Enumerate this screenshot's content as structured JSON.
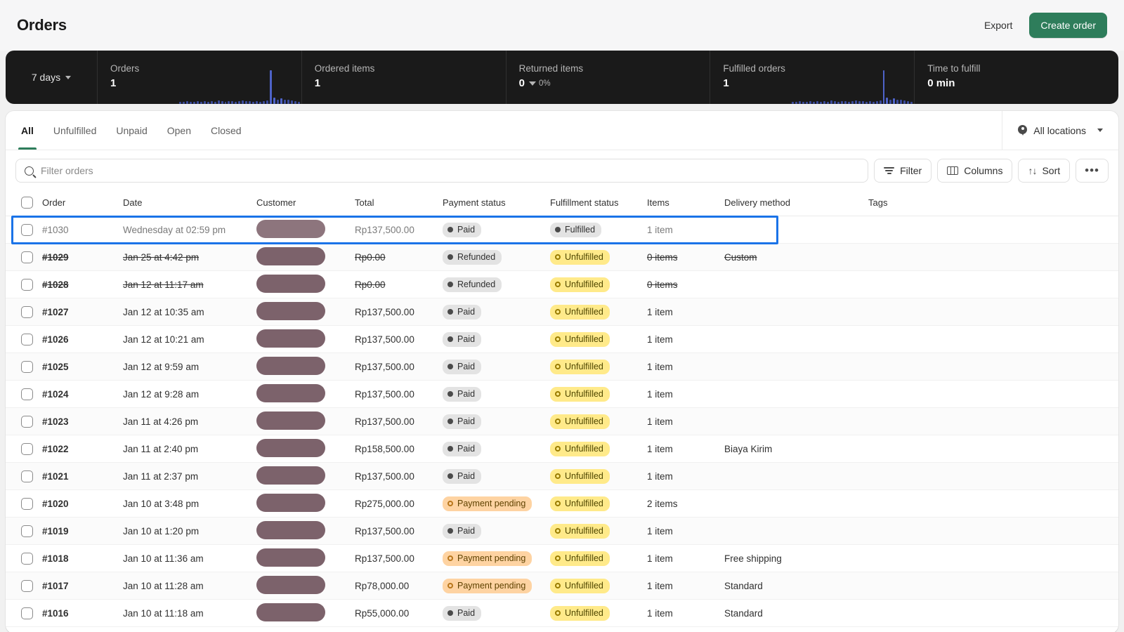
{
  "header": {
    "title": "Orders",
    "export_label": "Export",
    "create_label": "Create order"
  },
  "metrics": {
    "range_label": "7 days",
    "items": [
      {
        "label": "Orders",
        "value": "1",
        "delta": null,
        "spark": [
          2,
          2,
          3,
          2,
          2,
          3,
          2,
          3,
          2,
          3,
          2,
          4,
          3,
          2,
          3,
          3,
          2,
          3,
          4,
          3,
          3,
          2,
          3,
          2,
          3,
          4,
          38,
          7,
          5,
          6,
          5,
          5,
          4,
          3,
          2
        ]
      },
      {
        "label": "Ordered items",
        "value": "1",
        "delta": null,
        "spark": []
      },
      {
        "label": "Returned items",
        "value": "0",
        "delta": "0%",
        "spark": []
      },
      {
        "label": "Fulfilled orders",
        "value": "1",
        "delta": null,
        "spark": [
          2,
          2,
          3,
          2,
          2,
          3,
          2,
          3,
          2,
          3,
          2,
          4,
          3,
          2,
          3,
          3,
          2,
          3,
          4,
          3,
          3,
          2,
          3,
          2,
          3,
          4,
          38,
          7,
          5,
          6,
          5,
          5,
          4,
          3,
          2
        ]
      },
      {
        "label": "Time to fulfill",
        "value": "0 min",
        "delta": null,
        "spark": []
      }
    ]
  },
  "tabs": [
    {
      "label": "All",
      "active": true
    },
    {
      "label": "Unfulfilled",
      "active": false
    },
    {
      "label": "Unpaid",
      "active": false
    },
    {
      "label": "Open",
      "active": false
    },
    {
      "label": "Closed",
      "active": false
    }
  ],
  "locations": {
    "label": "All locations"
  },
  "search": {
    "placeholder": "Filter orders",
    "value": ""
  },
  "toolbar": {
    "filter_label": "Filter",
    "columns_label": "Columns",
    "sort_label": "Sort",
    "more_label": "•••"
  },
  "table": {
    "columns": [
      "Order",
      "Date",
      "Customer",
      "Total",
      "Payment status",
      "Fulfillment status",
      "Items",
      "Delivery method",
      "Tags"
    ],
    "rows": [
      {
        "order": "#1030",
        "date": "Wednesday at 02:59 pm",
        "customer_redacted": true,
        "total": "Rp137,500.00",
        "payment": "Paid",
        "payment_tone": "grey",
        "fulfillment": "Fulfilled",
        "fulfillment_tone": "grey",
        "items": "1 item",
        "delivery": "",
        "tags": "",
        "cancelled": false,
        "selected": true
      },
      {
        "order": "#1029",
        "date": "Jan 25 at 4:42 pm",
        "customer_redacted": true,
        "total": "Rp0.00",
        "payment": "Refunded",
        "payment_tone": "grey",
        "fulfillment": "Unfulfilled",
        "fulfillment_tone": "yellow",
        "items": "0 items",
        "delivery": "Custom",
        "tags": "",
        "cancelled": true,
        "selected": false
      },
      {
        "order": "#1028",
        "date": "Jan 12 at 11:17 am",
        "customer_redacted": true,
        "total": "Rp0.00",
        "payment": "Refunded",
        "payment_tone": "grey",
        "fulfillment": "Unfulfilled",
        "fulfillment_tone": "yellow",
        "items": "0 items",
        "delivery": "",
        "tags": "",
        "cancelled": true,
        "selected": false
      },
      {
        "order": "#1027",
        "date": "Jan 12 at 10:35 am",
        "customer_redacted": true,
        "total": "Rp137,500.00",
        "payment": "Paid",
        "payment_tone": "grey",
        "fulfillment": "Unfulfilled",
        "fulfillment_tone": "yellow",
        "items": "1 item",
        "delivery": "",
        "tags": "",
        "cancelled": false,
        "selected": false
      },
      {
        "order": "#1026",
        "date": "Jan 12 at 10:21 am",
        "customer_redacted": true,
        "total": "Rp137,500.00",
        "payment": "Paid",
        "payment_tone": "grey",
        "fulfillment": "Unfulfilled",
        "fulfillment_tone": "yellow",
        "items": "1 item",
        "delivery": "",
        "tags": "",
        "cancelled": false,
        "selected": false
      },
      {
        "order": "#1025",
        "date": "Jan 12 at 9:59 am",
        "customer_redacted": true,
        "total": "Rp137,500.00",
        "payment": "Paid",
        "payment_tone": "grey",
        "fulfillment": "Unfulfilled",
        "fulfillment_tone": "yellow",
        "items": "1 item",
        "delivery": "",
        "tags": "",
        "cancelled": false,
        "selected": false
      },
      {
        "order": "#1024",
        "date": "Jan 12 at 9:28 am",
        "customer_redacted": true,
        "total": "Rp137,500.00",
        "payment": "Paid",
        "payment_tone": "grey",
        "fulfillment": "Unfulfilled",
        "fulfillment_tone": "yellow",
        "items": "1 item",
        "delivery": "",
        "tags": "",
        "cancelled": false,
        "selected": false
      },
      {
        "order": "#1023",
        "date": "Jan 11 at 4:26 pm",
        "customer_redacted": true,
        "total": "Rp137,500.00",
        "payment": "Paid",
        "payment_tone": "grey",
        "fulfillment": "Unfulfilled",
        "fulfillment_tone": "yellow",
        "items": "1 item",
        "delivery": "",
        "tags": "",
        "cancelled": false,
        "selected": false
      },
      {
        "order": "#1022",
        "date": "Jan 11 at 2:40 pm",
        "customer_redacted": true,
        "total": "Rp158,500.00",
        "payment": "Paid",
        "payment_tone": "grey",
        "fulfillment": "Unfulfilled",
        "fulfillment_tone": "yellow",
        "items": "1 item",
        "delivery": "Biaya Kirim",
        "tags": "",
        "cancelled": false,
        "selected": false
      },
      {
        "order": "#1021",
        "date": "Jan 11 at 2:37 pm",
        "customer_redacted": true,
        "total": "Rp137,500.00",
        "payment": "Paid",
        "payment_tone": "grey",
        "fulfillment": "Unfulfilled",
        "fulfillment_tone": "yellow",
        "items": "1 item",
        "delivery": "",
        "tags": "",
        "cancelled": false,
        "selected": false
      },
      {
        "order": "#1020",
        "date": "Jan 10 at 3:48 pm",
        "customer_redacted": true,
        "total": "Rp275,000.00",
        "payment": "Payment pending",
        "payment_tone": "orange",
        "fulfillment": "Unfulfilled",
        "fulfillment_tone": "yellow",
        "items": "2 items",
        "delivery": "",
        "tags": "",
        "cancelled": false,
        "selected": false
      },
      {
        "order": "#1019",
        "date": "Jan 10 at 1:20 pm",
        "customer_redacted": true,
        "total": "Rp137,500.00",
        "payment": "Paid",
        "payment_tone": "grey",
        "fulfillment": "Unfulfilled",
        "fulfillment_tone": "yellow",
        "items": "1 item",
        "delivery": "",
        "tags": "",
        "cancelled": false,
        "selected": false
      },
      {
        "order": "#1018",
        "date": "Jan 10 at 11:36 am",
        "customer_redacted": true,
        "total": "Rp137,500.00",
        "payment": "Payment pending",
        "payment_tone": "orange",
        "fulfillment": "Unfulfilled",
        "fulfillment_tone": "yellow",
        "items": "1 item",
        "delivery": "Free shipping",
        "tags": "",
        "cancelled": false,
        "selected": false
      },
      {
        "order": "#1017",
        "date": "Jan 10 at 11:28 am",
        "customer_redacted": true,
        "total": "Rp78,000.00",
        "payment": "Payment pending",
        "payment_tone": "orange",
        "fulfillment": "Unfulfilled",
        "fulfillment_tone": "yellow",
        "items": "1 item",
        "delivery": "Standard",
        "tags": "",
        "cancelled": false,
        "selected": false
      },
      {
        "order": "#1016",
        "date": "Jan 10 at 11:18 am",
        "customer_redacted": true,
        "total": "Rp55,000.00",
        "payment": "Paid",
        "payment_tone": "grey",
        "fulfillment": "Unfulfilled",
        "fulfillment_tone": "yellow",
        "items": "1 item",
        "delivery": "Standard",
        "tags": "",
        "cancelled": false,
        "selected": false
      }
    ]
  },
  "colors": {
    "brand_green": "#2e7d5b",
    "selection_blue": "#1a73e8",
    "metrics_bg": "#1a1a1a",
    "spark_blue": "#4e63c8",
    "redaction": "#7c626b"
  }
}
